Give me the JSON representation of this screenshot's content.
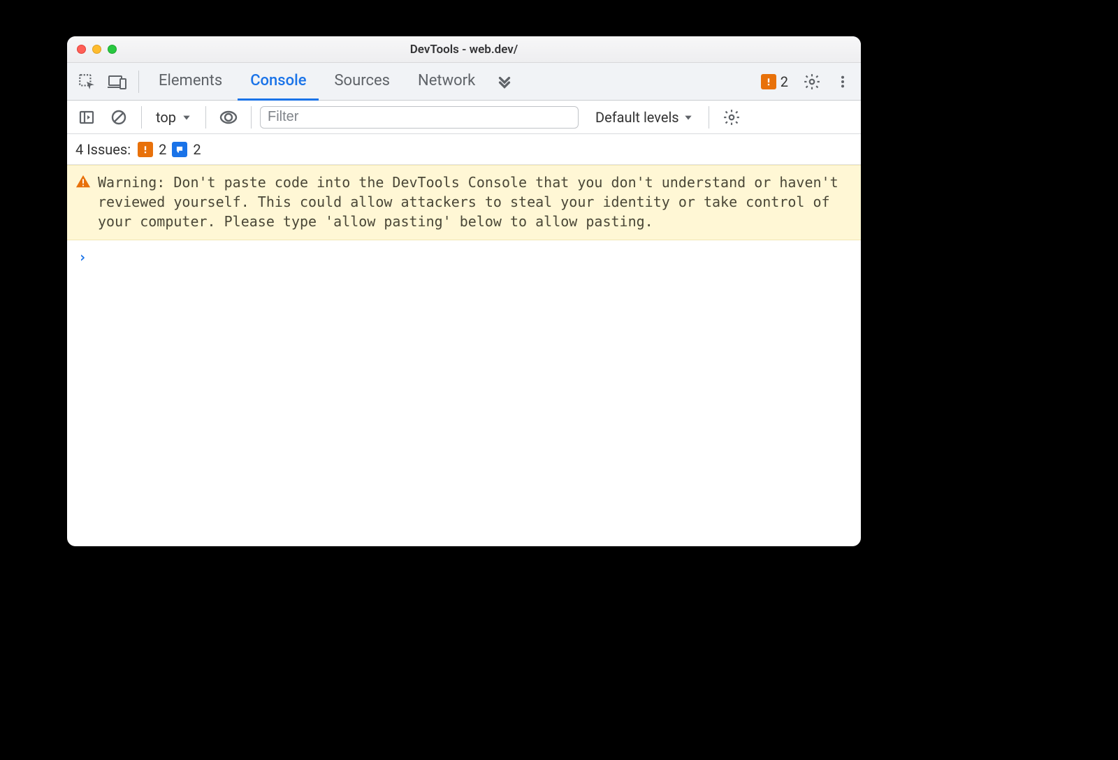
{
  "window": {
    "title": "DevTools - web.dev/"
  },
  "tabs": {
    "items": [
      "Elements",
      "Console",
      "Sources",
      "Network"
    ],
    "active_index": 1,
    "error_count": "2"
  },
  "toolbar": {
    "context_label": "top",
    "filter_placeholder": "Filter",
    "levels_label": "Default levels"
  },
  "issues": {
    "label": "4 Issues:",
    "warn_count": "2",
    "info_count": "2"
  },
  "warning": {
    "text": "Warning: Don't paste code into the DevTools Console that you don't understand or haven't reviewed yourself. This could allow attackers to steal your identity or take control of your computer. Please type 'allow pasting' below to allow pasting."
  },
  "prompt": {
    "symbol": "›"
  }
}
